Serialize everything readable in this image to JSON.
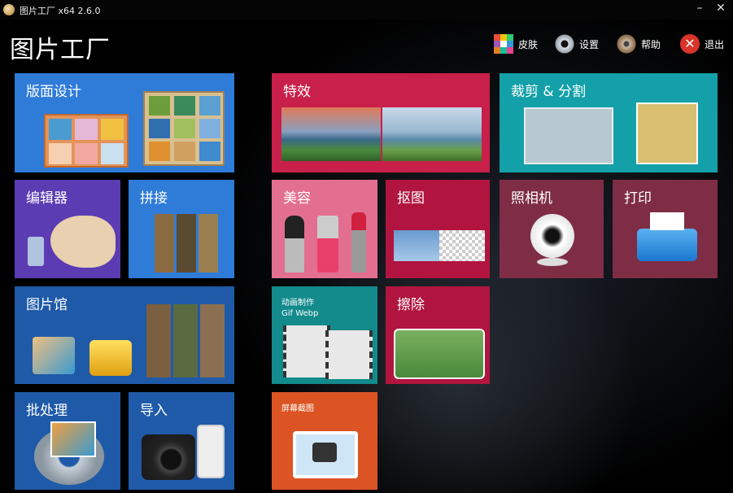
{
  "window": {
    "title": "图片工厂 x64 2.6.0",
    "minimize_glyph": "–",
    "close_glyph": "✕"
  },
  "header": {
    "title": "图片工厂",
    "buttons": [
      {
        "label": "皮肤",
        "icon": "skin-icon"
      },
      {
        "label": "设置",
        "icon": "gear-icon"
      },
      {
        "label": "帮助",
        "icon": "help-icon"
      },
      {
        "label": "退出",
        "icon": "exit-icon",
        "glyph": "✕"
      }
    ]
  },
  "tiles": {
    "layout_design": {
      "label": "版面设计",
      "color": "#2f7bd8"
    },
    "effects": {
      "label": "特效",
      "color": "#c8204a"
    },
    "crop_split": {
      "label": "裁剪 & 分割",
      "color": "#14a0a8"
    },
    "editor": {
      "label": "编辑器",
      "color": "#5b3cb3"
    },
    "stitch": {
      "label": "拼接",
      "color": "#2f7bd8"
    },
    "beauty": {
      "label": "美容",
      "color": "#e36f90"
    },
    "cutout": {
      "label": "抠图",
      "color": "#b1153f"
    },
    "camera": {
      "label": "照相机",
      "color": "#7f2d45"
    },
    "print": {
      "label": "打印",
      "color": "#7f2d45"
    },
    "gallery": {
      "label": "图片馆",
      "color": "#1f5aa8"
    },
    "animation": {
      "label_line1": "动画制作",
      "label_line2": "Gif Webp",
      "color": "#138a8c"
    },
    "erase": {
      "label": "擦除",
      "color": "#b1153f"
    },
    "batch": {
      "label": "批处理",
      "color": "#1f5aa8"
    },
    "import": {
      "label": "导入",
      "color": "#1f5aa8"
    },
    "screenshot": {
      "label": "屏幕截图",
      "color": "#dc5423"
    }
  }
}
